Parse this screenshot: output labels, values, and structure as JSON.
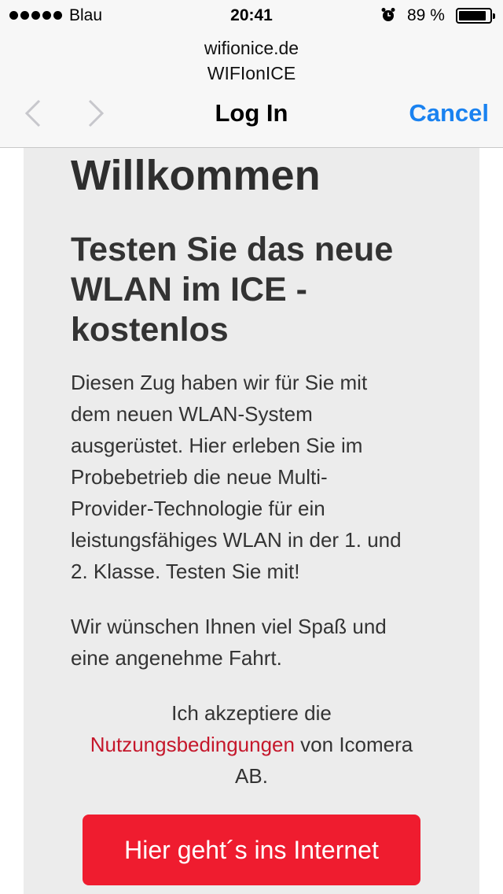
{
  "status_bar": {
    "carrier": "Blau",
    "time": "20:41",
    "battery_percent": "89 %",
    "battery_level": 0.89
  },
  "browser": {
    "domain": "wifionice.de",
    "network_name": "WIFIonICE",
    "title": "Log In",
    "cancel_label": "Cancel",
    "accent_color": "#1a82f0"
  },
  "page": {
    "welcome": "Willkommen",
    "headline_lines": [
      "Testen Sie das neue",
      "WLAN im ICE -",
      "kostenlos"
    ],
    "intro_lines": [
      "Diesen Zug haben wir für Sie mit",
      "dem neuen WLAN-System",
      "ausgerüstet. Hier erleben Sie im",
      "Probebetrieb die neue Multi-",
      "Provider-Technologie für ein",
      "leistungsfähiges WLAN in der 1. und",
      "2. Klasse. Testen Sie mit!"
    ],
    "wish_lines": [
      "Wir wünschen Ihnen viel Spaß und",
      "eine angenehme Fahrt."
    ],
    "accept_prefix": "Ich akzeptiere die",
    "terms_link": "Nutzungsbedingungen",
    "accept_suffix_1": " von Icomera",
    "accept_suffix_2": "AB.",
    "cta_label": "Hier geht´s ins Internet",
    "cta_color": "#ef1c2f",
    "link_color": "#c5172b"
  }
}
